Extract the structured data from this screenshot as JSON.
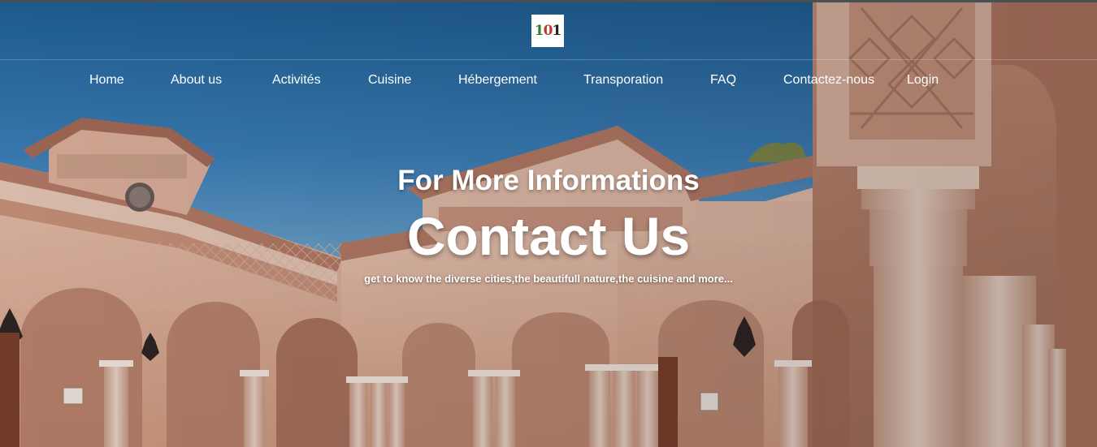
{
  "logo": {
    "parts": [
      "1",
      "0",
      "1"
    ]
  },
  "nav": {
    "items": [
      {
        "label": "Home"
      },
      {
        "label": "About us"
      },
      {
        "label": "Activités"
      },
      {
        "label": "Cuisine"
      },
      {
        "label": "Hébergement"
      },
      {
        "label": "Transporation"
      },
      {
        "label": "FAQ"
      },
      {
        "label": "Contactez-nous"
      },
      {
        "label": "Login"
      }
    ]
  },
  "hero": {
    "subtitle": "For More Informations",
    "title": "Contact Us",
    "tagline": "get to know the diverse cities,the beautifull nature,the cuisine and more..."
  },
  "colors": {
    "sky_top": "#1f5f95",
    "sky_mid": "#3c7fb8",
    "sky_low": "#8dbcd9",
    "building": "#d8a589",
    "roof": "#b57a66",
    "text": "#ffffff"
  }
}
